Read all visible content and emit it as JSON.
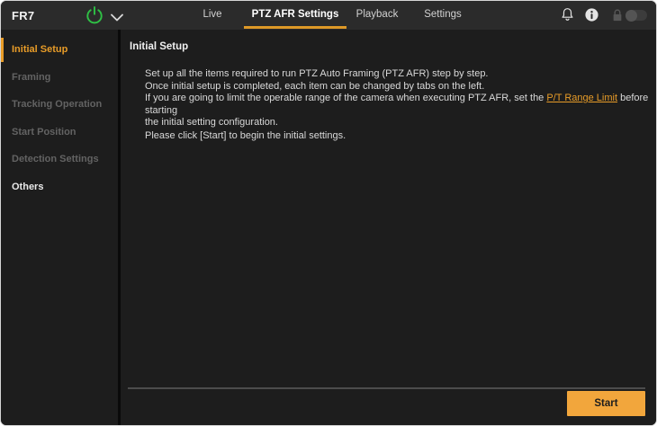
{
  "topbar": {
    "brand": "FR7",
    "tabs": [
      {
        "label": "Live",
        "active": false
      },
      {
        "label": "PTZ AFR Settings",
        "active": true
      },
      {
        "label": "Playback",
        "active": false
      },
      {
        "label": "Settings",
        "active": false
      }
    ],
    "icons": [
      "power-icon",
      "chevron-down-icon",
      "bell-icon",
      "info-icon",
      "lock-icon",
      "lock-toggle"
    ]
  },
  "sidebar": {
    "items": [
      {
        "label": "Initial Setup",
        "state": "active"
      },
      {
        "label": "Framing",
        "state": "disabled"
      },
      {
        "label": "Tracking Operation",
        "state": "disabled"
      },
      {
        "label": "Start Position",
        "state": "disabled"
      },
      {
        "label": "Detection Settings",
        "state": "disabled"
      },
      {
        "label": "Others",
        "state": "normal"
      }
    ]
  },
  "main": {
    "heading": "Initial Setup",
    "intro": {
      "line1": "Set up all the items required to run PTZ Auto Framing (PTZ AFR) step by step.",
      "line2": "Once initial setup is completed, each item can be changed by tabs on the left.",
      "line3_before": "If you are going to limit the operable range of the camera when executing PTZ AFR, set the ",
      "line3_link": "P/T Range Limit",
      "line3_after": " before starting",
      "line4": "the initial setting configuration.",
      "prompt": "Please click [Start] to begin the initial settings."
    },
    "start_button_label": "Start"
  },
  "colors": {
    "accent_orange": "#E89C28",
    "button_orange": "#F2A63C",
    "power_green": "#2FC045",
    "topbar_bg": "#2B2B2B",
    "panel_bg": "#1D1D1D"
  }
}
